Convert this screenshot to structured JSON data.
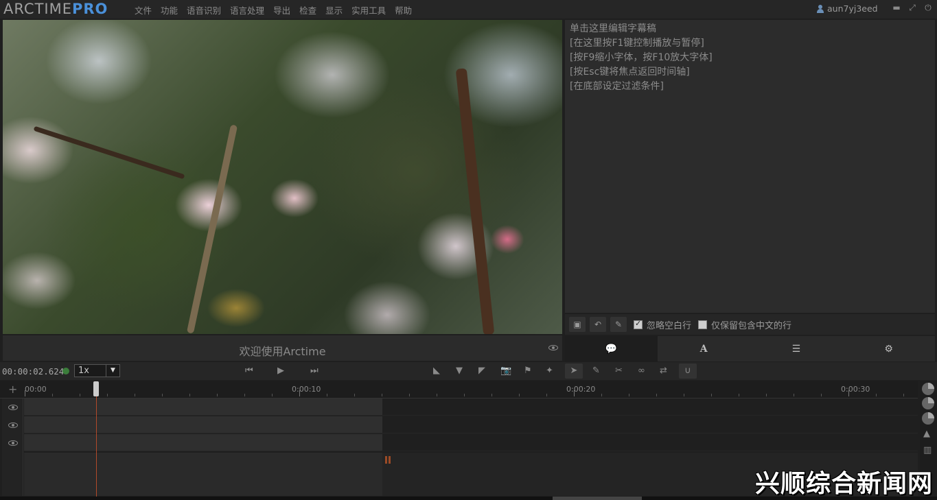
{
  "app": {
    "logo_main": "ARCTIME",
    "logo_pro": "PRO",
    "menu": [
      "文件",
      "功能",
      "语音识别",
      "语言处理",
      "导出",
      "检查",
      "显示",
      "实用工具",
      "帮助"
    ],
    "username": "aun7yj3eed",
    "window_buttons": [
      "▬",
      "⤢",
      "⏻"
    ]
  },
  "video": {
    "caption": "欢迎使用Arctime"
  },
  "editor": {
    "lines": [
      "单击这里编辑字幕稿",
      "[在这里按F1键控制播放与暂停]",
      "[按F9缩小字体，按F10放大字体]",
      "[按Esc键将焦点返回时间轴]",
      "[在底部设定过滤条件]"
    ],
    "option_ignore_blank": "忽略空白行",
    "option_ignore_blank_checked": true,
    "option_chinese_only": "仅保留包含中文的行",
    "option_chinese_only_checked": false,
    "tabs": [
      "💬",
      "A",
      "☰",
      "⚙"
    ]
  },
  "transport": {
    "timecode": "00:00:02.624",
    "speed": "1x",
    "speed_arrow": "▼"
  },
  "timeline": {
    "labels": [
      "00:00",
      "0:00:10",
      "0:00:20",
      "0:00:30"
    ]
  },
  "watermark": "兴顺综合新闻网",
  "colors": {
    "accent": "#4a90d9",
    "playhead": "#b24a2a",
    "status_dot": "#3b7d3b"
  }
}
